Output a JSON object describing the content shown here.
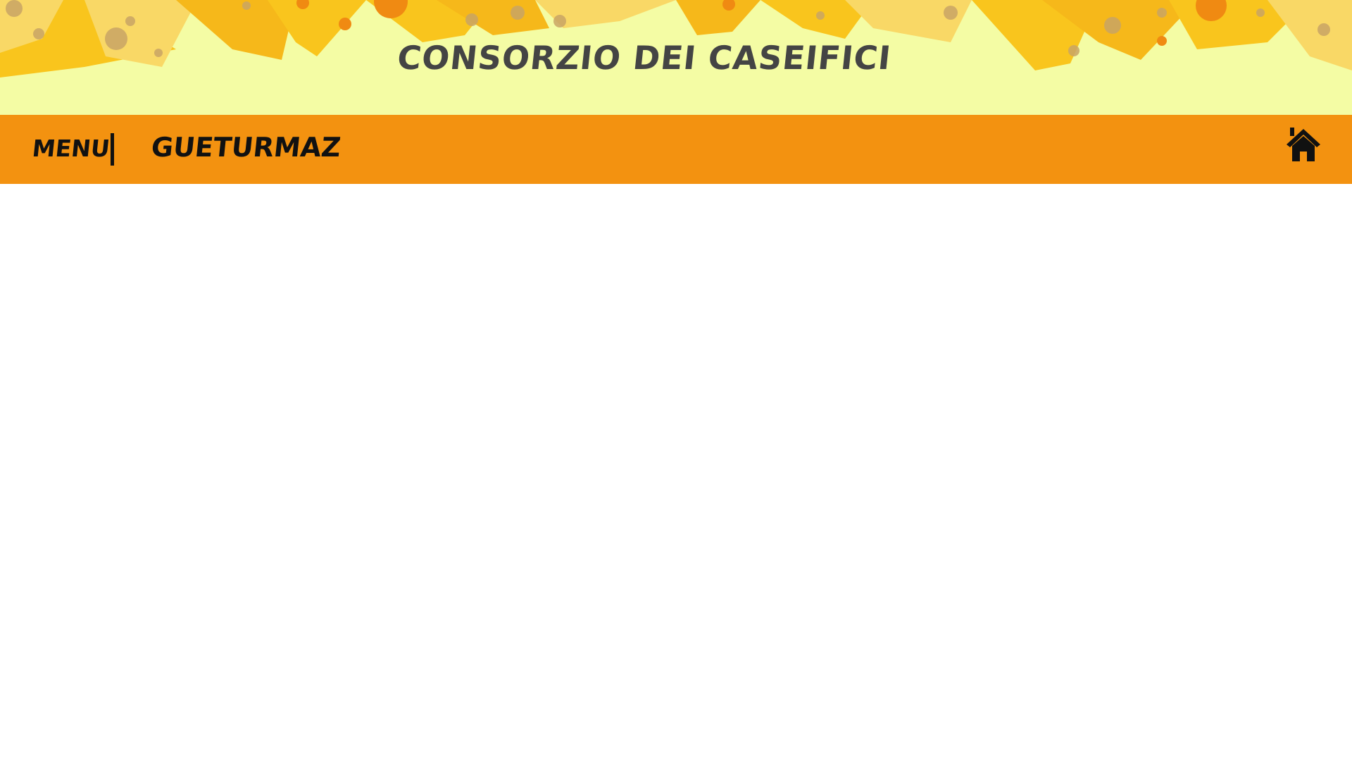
{
  "header": {
    "title": "CONSORZIO DEI CASEIFICI"
  },
  "navbar": {
    "menu_label": "MENU",
    "brand_label": "GUETURMAZ",
    "home_icon": "home-icon"
  },
  "colors": {
    "header_bg": "#f4fca4",
    "navbar_bg": "#f39210",
    "cheese_yellow": "#f9c51d",
    "cheese_light": "#f9d866",
    "cheese_holes": "#c9a565",
    "accent_orange": "#f08a12",
    "text_dark": "#111111",
    "title_color": "#444444"
  }
}
